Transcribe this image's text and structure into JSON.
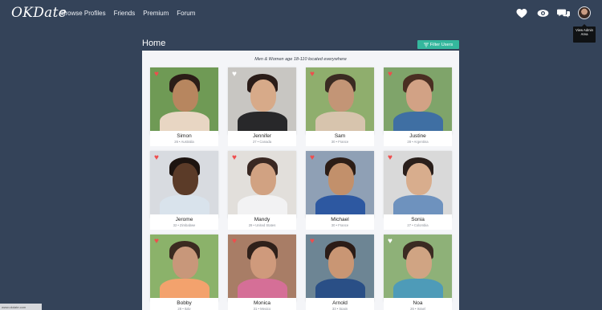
{
  "brand": {
    "logo": "OKDate"
  },
  "nav": {
    "links": [
      "Browse Profiles",
      "Friends",
      "Premium",
      "Forum"
    ]
  },
  "tooltip": {
    "text": "View Admin Area"
  },
  "page": {
    "title": "Home",
    "filter_button": "Filter Users",
    "subtitle": "Men & Women age 18-110 located everywhere"
  },
  "profiles": [
    {
      "name": "Simon",
      "info": "26 • Australia",
      "heart": "red",
      "colors": {
        "bg": "#6f9a55",
        "skin": "#b7865f",
        "hair": "#2b1d17",
        "shirt": "#e8d6c3"
      }
    },
    {
      "name": "Jennifer",
      "info": "27 • Canada",
      "heart": "white",
      "colors": {
        "bg": "#c8c6c2",
        "skin": "#d7aa89",
        "hair": "#2a1c18",
        "shirt": "#28282a"
      }
    },
    {
      "name": "Sam",
      "info": "30 • France",
      "heart": "red",
      "colors": {
        "bg": "#8fae6d",
        "skin": "#c39576",
        "hair": "#3a2b22",
        "shirt": "#d7c4ad"
      }
    },
    {
      "name": "Justine",
      "info": "28 • Argentina",
      "heart": "red",
      "colors": {
        "bg": "#7fa46a",
        "skin": "#d2a285",
        "hair": "#4a2f22",
        "shirt": "#3f6fa3"
      }
    },
    {
      "name": "Jerome",
      "info": "32 • Zimbabwe",
      "heart": "red",
      "colors": {
        "bg": "#d8dbe0",
        "skin": "#5b3b28",
        "hair": "#1d1410",
        "shirt": "#d9e3ec"
      }
    },
    {
      "name": "Mandy",
      "info": "29 • United States",
      "heart": "red",
      "colors": {
        "bg": "#e2dfdb",
        "skin": "#d1a282",
        "hair": "#3a2822",
        "shirt": "#f2f2f3"
      }
    },
    {
      "name": "Michael",
      "info": "30 • France",
      "heart": "red",
      "colors": {
        "bg": "#8fa0b5",
        "skin": "#c2906b",
        "hair": "#2c1d16",
        "shirt": "#2d58a1"
      }
    },
    {
      "name": "Sonia",
      "info": "27 • Colombia",
      "heart": "red",
      "colors": {
        "bg": "#d9d9d9",
        "skin": "#d8ad8d",
        "hair": "#2a1f1b",
        "shirt": "#6e92be"
      }
    },
    {
      "name": "Bobby",
      "info": "28 • Italy",
      "heart": "red",
      "colors": {
        "bg": "#8bb26a",
        "skin": "#c8977a",
        "hair": "#3b2a20",
        "shirt": "#f3a26d"
      }
    },
    {
      "name": "Monica",
      "info": "31 • Mexico",
      "heart": "red",
      "colors": {
        "bg": "#a87d66",
        "skin": "#cf9a7c",
        "hair": "#2f201a",
        "shirt": "#d56f97"
      }
    },
    {
      "name": "Arnold",
      "info": "33 • Spain",
      "heart": "red",
      "colors": {
        "bg": "#6d8594",
        "skin": "#c99674",
        "hair": "#2b1c17",
        "shirt": "#2a4f86"
      }
    },
    {
      "name": "Noa",
      "info": "26 • Israel",
      "heart": "white",
      "colors": {
        "bg": "#8eb178",
        "skin": "#d0a483",
        "hair": "#3b2b22",
        "shirt": "#4e9bb8"
      }
    }
  ],
  "status_bar": {
    "text": "www.okdate.com"
  }
}
